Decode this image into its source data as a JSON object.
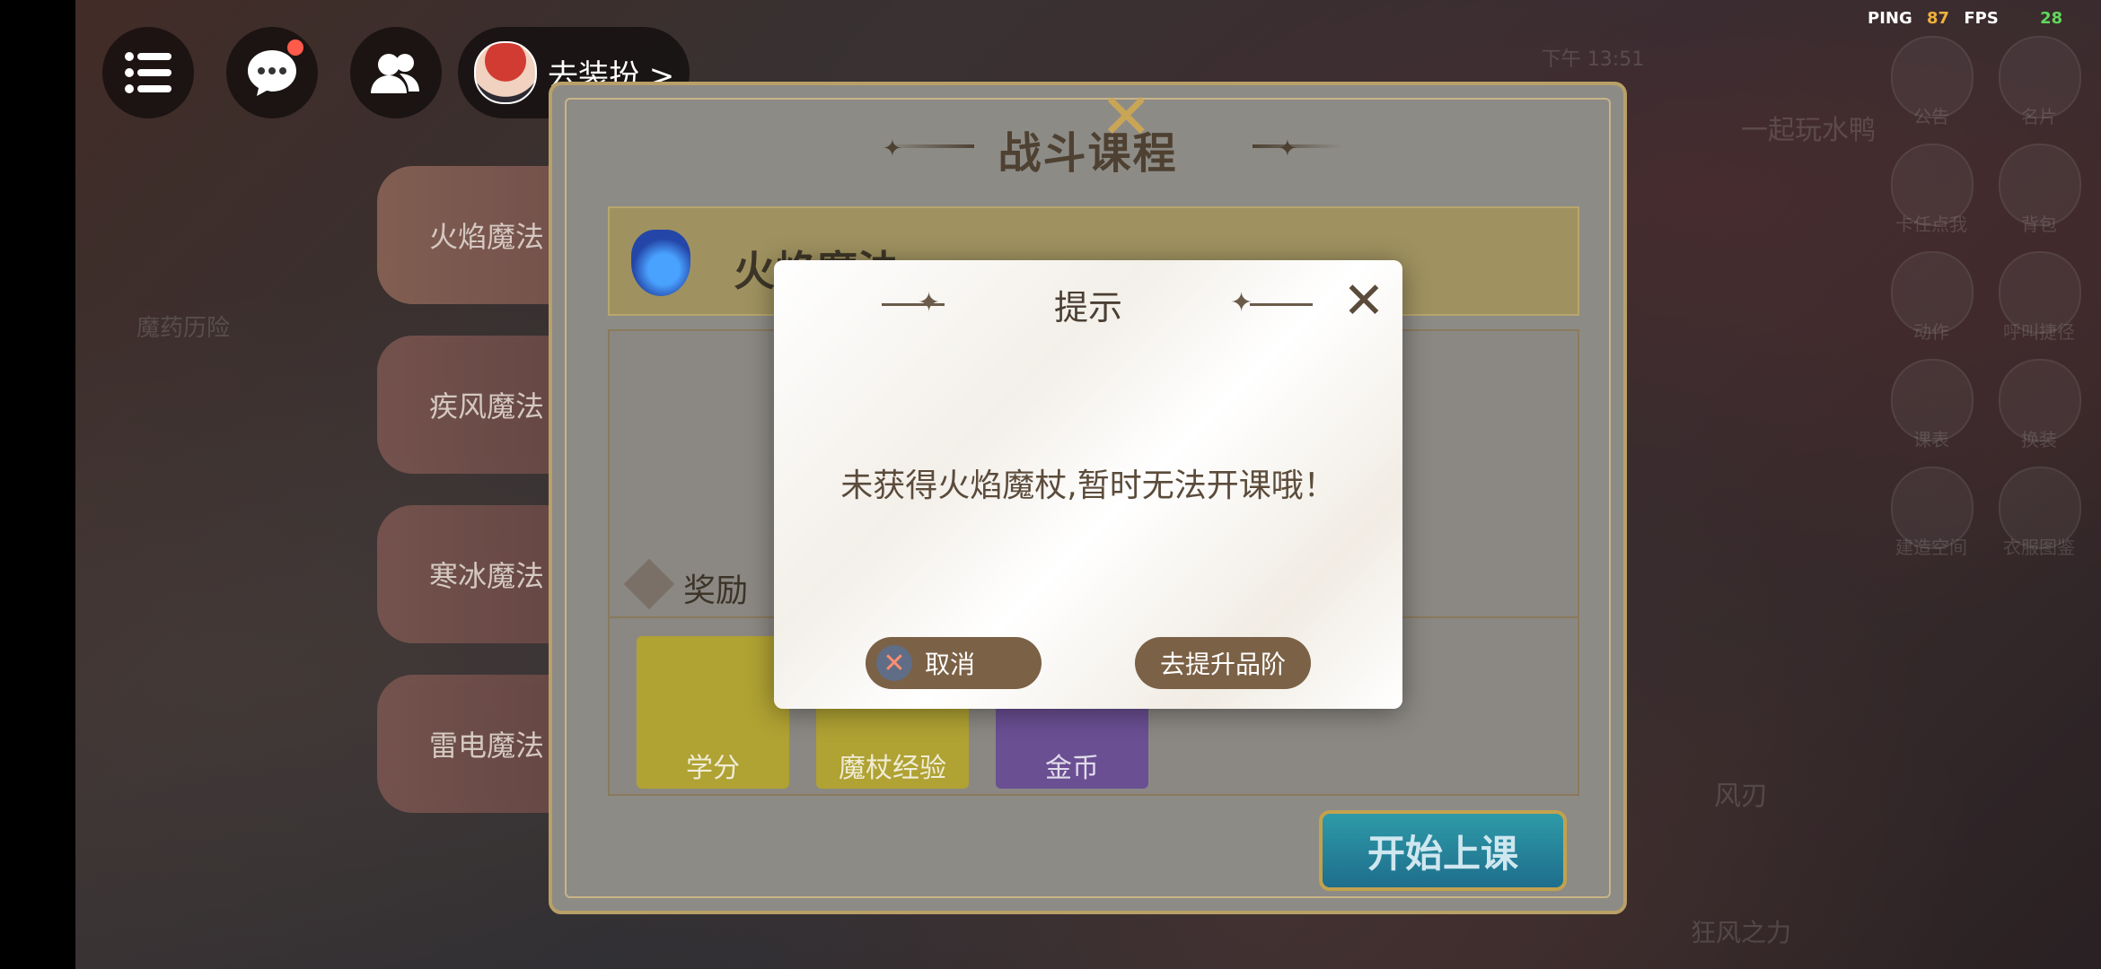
{
  "hud": {
    "menu_icon": "list-icon",
    "chat_icon": "chat-bubble-icon",
    "friends_icon": "friends-icon",
    "dress_label": "去装扮 >"
  },
  "perf": {
    "ping_label": "PING",
    "ping_value": "87",
    "fps_label": "FPS",
    "fps_value": "28"
  },
  "background_labels": {
    "time": "下午 13:51",
    "duck": "一起玩水鸭",
    "notice": "公告",
    "card": "名片",
    "skill_points": "卡任点我",
    "bag": "背包",
    "action": "动作",
    "call_tree": "呼叫捷径",
    "course": "课表",
    "swap": "换装",
    "build": "建造空间",
    "dress_dex": "衣服图鉴",
    "wind_blade": "风刃",
    "wind_stage": "狂风之力",
    "left_label": "魔药历险"
  },
  "panel": {
    "title": "战斗课程",
    "current_course": "火焰魔法",
    "reward_title": "奖励",
    "rewards": [
      {
        "label": "学分",
        "color": "#b0a233"
      },
      {
        "label": "魔杖经验",
        "color": "#b0a233"
      },
      {
        "label": "金币",
        "color": "#6a4f93"
      }
    ],
    "start_button": "开始上课"
  },
  "tabs": [
    "火焰魔法",
    "疾风魔法",
    "寒冰魔法",
    "雷电魔法"
  ],
  "modal": {
    "title": "提示",
    "message": "未获得火焰魔杖,暂时无法开课哦！",
    "cancel_label": "取消",
    "upgrade_label": "去提升品阶"
  }
}
